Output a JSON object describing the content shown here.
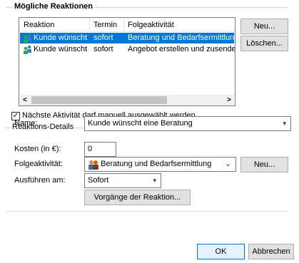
{
  "reactions_group": {
    "title": "Mögliche Reaktionen"
  },
  "reactions_list": {
    "columns": [
      "Reaktion",
      "Termin",
      "Folgeaktivität"
    ],
    "rows": [
      {
        "reaktion": "Kunde wünscht ...",
        "termin": "sofort",
        "folge": "Beratung und Bedarfsermittlung",
        "selected": true
      },
      {
        "reaktion": "Kunde wünscht ...",
        "termin": "sofort",
        "folge": "Angebot erstellen und zusenden",
        "selected": false
      }
    ],
    "scroll_left": "<",
    "scroll_right": ">"
  },
  "list_buttons": {
    "new": "Neu...",
    "delete": "Löschen..."
  },
  "manual_checkbox": {
    "label": "Nächste Aktivität darf manuell ausgewählt werden",
    "checked": true,
    "check_glyph": "✓"
  },
  "details_group": {
    "title": "Reaktions-Details"
  },
  "details": {
    "name_label": "Name:",
    "name_value": "Kunde wünscht eine Beratung",
    "cost_label": "Kosten (in €):",
    "cost_value": "0",
    "followup_label": "Folgeaktivität:",
    "followup_value": "Beratung und Bedarfsermittlung",
    "followup_new": "Neu...",
    "execute_label": "Ausführen am:",
    "execute_value": "Sofort",
    "processes_button": "Vorgänge der Reaktion..."
  },
  "dialog_buttons": {
    "ok": "OK",
    "cancel": "Abbrechen"
  },
  "colors": {
    "selection": "#0078d7",
    "accent_border": "#0078d7"
  },
  "icons": {
    "row_icon": "users-icon",
    "followup_icon": "people-icon",
    "dropdown": "chevron-down-icon"
  }
}
